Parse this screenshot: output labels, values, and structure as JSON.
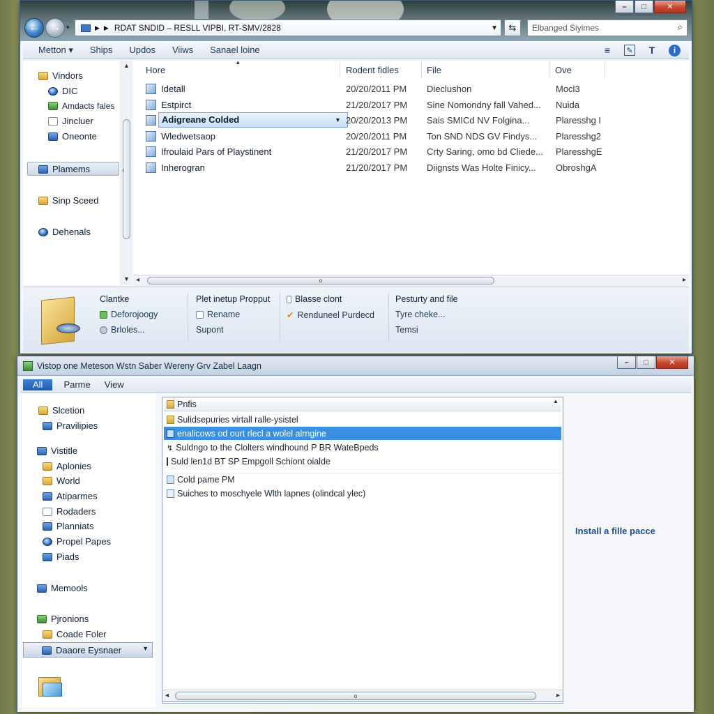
{
  "window1": {
    "address": {
      "breadcrumb": "RDAT SNDID  –  RESLL VIPBI,  RT-SMV/2828"
    },
    "search": {
      "placeholder": "Elbanged Siyimes"
    },
    "toolbar": {
      "items": [
        "Metton",
        "Ships",
        "Updos",
        "Viiws",
        "Sanael loine"
      ]
    },
    "sidebar": {
      "items": [
        {
          "label": "Vindors",
          "icon": "folder-icon"
        },
        {
          "label": "DIC",
          "icon": "globe-icon"
        },
        {
          "label": "Amdacts fales",
          "icon": "users-icon"
        },
        {
          "label": "Jincluer",
          "icon": "folder-icon"
        },
        {
          "label": "Oneonte",
          "icon": "app-icon"
        },
        {
          "label": "Plamems",
          "icon": "document-icon"
        },
        {
          "label": "Sinp Sceed",
          "icon": "folder-icon"
        },
        {
          "label": "Dehenals",
          "icon": "globe-icon"
        }
      ]
    },
    "columns": [
      "Hore",
      "Rodent fidles",
      "File",
      "Ove"
    ],
    "files": [
      {
        "name": "Idetall",
        "date": "20/20/2011 PM",
        "file": "Dieclushon",
        "ove": "Mocl3"
      },
      {
        "name": "Estpirct",
        "date": "21/20/2017 PM",
        "file": "Sine Nomondny fall Vahed...",
        "ove": "Nuida"
      },
      {
        "name": "Adigreane Colded",
        "date": "20/20/2013 PM",
        "file": "Sais SMICd NV Folgina...",
        "ove": "Plaresshg I"
      },
      {
        "name": "Wledwetsaop",
        "date": "20/20/2011 PM",
        "file": "Ton SND NDS GV Findys...",
        "ove": "Plaresshg2"
      },
      {
        "name": "Ifroulaid Pars of Playstinent",
        "date": "21/20/2017 PM",
        "file": "Crty Saring, omo bd Cliede...",
        "ove": "PlaresshgE"
      },
      {
        "name": "Inherogran",
        "date": "21/20/2017 PM",
        "file": "Diignsts Was Holte Finicy...",
        "ove": "ObroshgA"
      }
    ],
    "details": {
      "col1": [
        "Clantke",
        "Deforojoogy",
        "Brloles..."
      ],
      "col2": [
        "Plet inetup Propput",
        "Rename",
        "Supont"
      ],
      "col3": [
        "Blasse clont",
        "Renduneel Purdecd"
      ],
      "col4": [
        "Pesturty and file",
        "Tyre cheke...",
        "Temsi"
      ]
    }
  },
  "window2": {
    "title": "Vistop one Meteson Wstn Saber Wereny Grv Zabel Laagn",
    "menu": [
      "All",
      "Parme",
      "View"
    ],
    "sidebar": {
      "groups": [
        {
          "label": "Slcetion",
          "icon": "folder-icon"
        },
        {
          "label": "Pravilipies",
          "icon": "settings-icon"
        },
        {
          "label": "Vistitle",
          "icon": "network-icon"
        },
        {
          "label": "Aplonies",
          "icon": "folder-icon"
        },
        {
          "label": "World",
          "icon": "folder-icon"
        },
        {
          "label": "Atiparmes",
          "icon": "app-icon"
        },
        {
          "label": "Rodaders",
          "icon": "tool-icon"
        },
        {
          "label": "Planniats",
          "icon": "app-icon"
        },
        {
          "label": "Propel Papes",
          "icon": "globe-icon"
        },
        {
          "label": "Piads",
          "icon": "image-icon"
        },
        {
          "label": "Memools",
          "icon": "computer-icon"
        },
        {
          "label": "Pjronions",
          "icon": "network-icon"
        },
        {
          "label": "Coade Foler",
          "icon": "folder-icon"
        },
        {
          "label": "Daaore Eysnaer",
          "icon": "disk-icon"
        }
      ]
    },
    "list": {
      "header": "Pnfis",
      "rows": [
        "Sulidsepuries virtall ralle-ysistel",
        "enalicows od ourt rlecl a wolel alrngine",
        "Suldngo to the Clolters windhound P BR WateBpeds",
        "Suld len1d BT SP Empgoll Schiont oialde",
        "Cold pame PM",
        "Suiches to moschyele Wlth lapnes (olindcal ylec)"
      ]
    },
    "install_link": "Install a fille pacce"
  }
}
